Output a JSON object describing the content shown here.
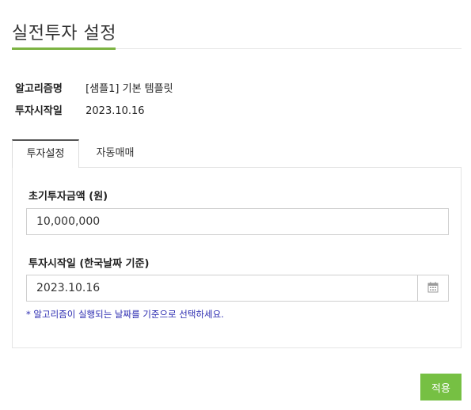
{
  "dialog": {
    "title": "실전투자 설정"
  },
  "info": {
    "algorithm_label": "알고리즘명",
    "algorithm_value": "[샘플1] 기본 템플릿",
    "start_label": "투자시작일",
    "start_value": "2023.10.16"
  },
  "tabs": [
    {
      "label": "투자설정",
      "active": true
    },
    {
      "label": "자동매매",
      "active": false
    }
  ],
  "form": {
    "amount_label": "초기투자금액 (원)",
    "amount_value": "10,000,000",
    "date_label": "투자시작일 (한국날짜 기준)",
    "date_value": "2023.10.16",
    "hint": "* 알고리즘이 실행되는 날짜를 기준으로 선택하세요."
  },
  "actions": {
    "apply_label": "적용"
  },
  "icons": {
    "calendar": "calendar-icon"
  },
  "colors": {
    "accent": "#7cb342",
    "apply_button": "#76c043",
    "hint_text": "#2a2ab0"
  }
}
